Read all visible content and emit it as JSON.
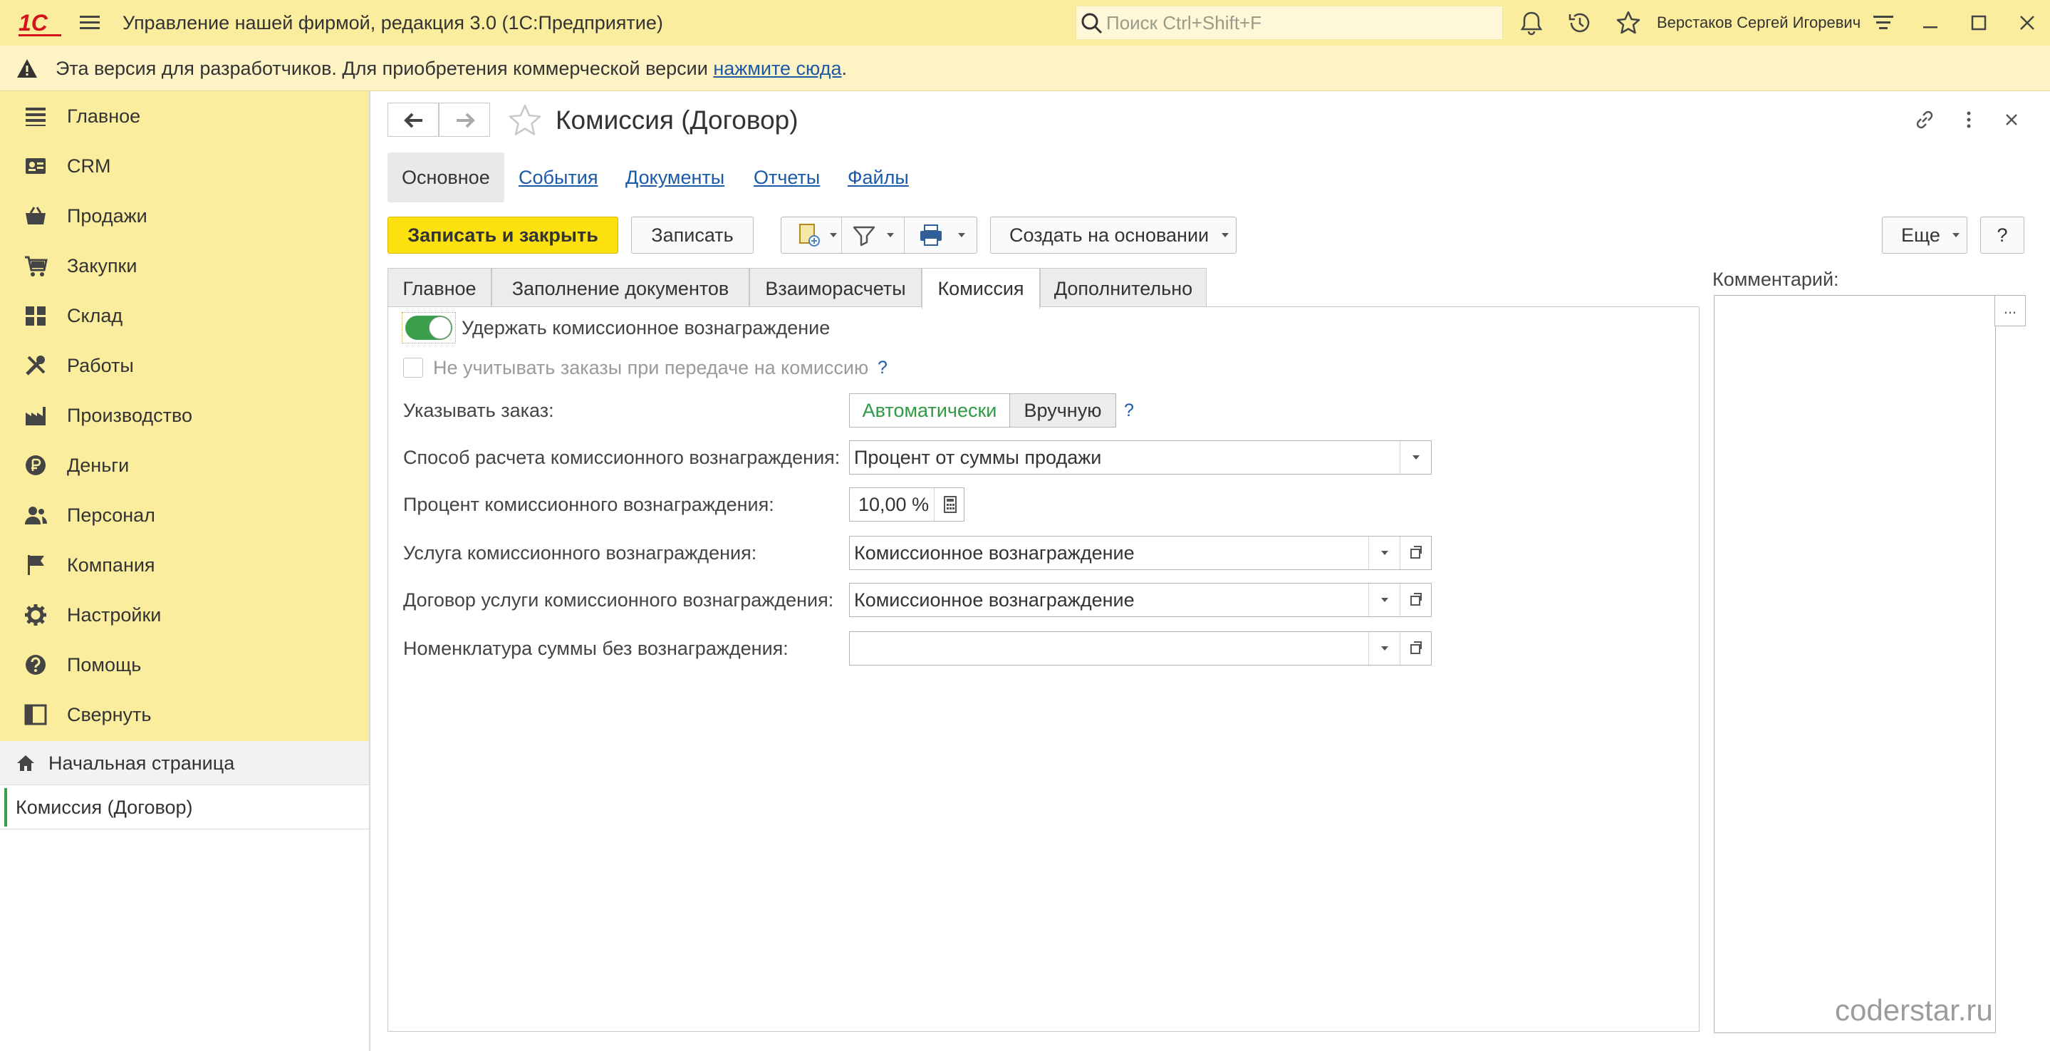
{
  "titlebar": {
    "logo": "1С",
    "app_title": "Управление нашей фирмой, редакция 3.0  (1С:Предприятие)",
    "search_placeholder": "Поиск Ctrl+Shift+F",
    "user": "Верстаков Сергей Игоревич"
  },
  "banner": {
    "text": "Эта версия для разработчиков. Для приобретения коммерческой версии ",
    "link": "нажмите сюда",
    "tail": "."
  },
  "sidebar": {
    "sections": [
      {
        "label": "Главное",
        "icon": "menu-lines-icon"
      },
      {
        "label": "CRM",
        "icon": "contact-card-icon"
      },
      {
        "label": "Продажи",
        "icon": "basket-icon"
      },
      {
        "label": "Закупки",
        "icon": "cart-icon"
      },
      {
        "label": "Склад",
        "icon": "warehouse-grid-icon"
      },
      {
        "label": "Работы",
        "icon": "tools-icon"
      },
      {
        "label": "Производство",
        "icon": "factory-icon"
      },
      {
        "label": "Деньги",
        "icon": "ruble-coin-icon"
      },
      {
        "label": "Персонал",
        "icon": "people-icon"
      },
      {
        "label": "Компания",
        "icon": "flag-icon"
      },
      {
        "label": "Настройки",
        "icon": "gear-icon"
      },
      {
        "label": "Помощь",
        "icon": "question-circle-icon"
      },
      {
        "label": "Свернуть",
        "icon": "collapse-panel-icon"
      }
    ],
    "open_windows": [
      {
        "label": "Начальная страница"
      },
      {
        "label": "Комиссия (Договор)"
      }
    ]
  },
  "document": {
    "title": "Комиссия (Договор)",
    "nav_tabs": [
      "Основное",
      "События",
      "Документы",
      "Отчеты",
      "Файлы"
    ],
    "toolbar": {
      "save_close": "Записать и закрыть",
      "save": "Записать",
      "create_based": "Создать на основании",
      "more": "Еще",
      "help": "?"
    },
    "form_tabs": [
      "Главное",
      "Заполнение документов",
      "Взаиморасчеты",
      "Комиссия",
      "Дополнительно"
    ],
    "active_form_tab": "Комиссия",
    "fields": {
      "withhold_toggle_label": "Удержать комиссионное вознаграждение",
      "withhold_toggle_on": true,
      "ignore_orders_label": "Не учитывать заказы при передаче на комиссию",
      "ignore_orders_checked": false,
      "specify_order_label": "Указывать заказ:",
      "specify_order_options": [
        "Автоматически",
        "Вручную"
      ],
      "specify_order_selected": "Автоматически",
      "calc_method_label": "Способ расчета комиссионного вознаграждения:",
      "calc_method_value": "Процент от суммы продажи",
      "percent_label": "Процент комиссионного вознаграждения:",
      "percent_value": "10,00 %",
      "service_label": "Услуга комиссионного вознаграждения:",
      "service_value": "Комиссионное вознаграждение",
      "contract_label": "Договор услуги комиссионного вознаграждения:",
      "contract_value": "Комиссионное вознаграждение",
      "nomenclature_label": "Номенклатура суммы без вознаграждения:",
      "nomenclature_value": "",
      "help_mark": "?"
    },
    "comment_label": "Комментарий:",
    "comment_value": "",
    "comment_button": "..."
  },
  "watermark": "coderstar.ru",
  "colors": {
    "brand_red": "#D4141B",
    "sections_bg": "#FBED9E",
    "primary_button": "#FCE10E",
    "link": "#1c5aa8",
    "toggle_on": "#3a9e4a",
    "selected_segment": "#2e9a43"
  }
}
